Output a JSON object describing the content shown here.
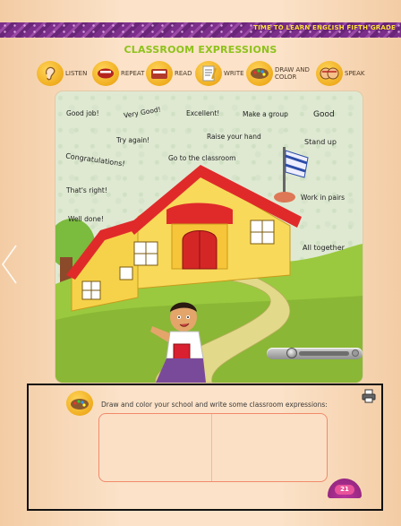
{
  "header": {
    "banner_text": "TIME TO LEARN ENGLISH FIFTH GRADE",
    "title": "CLASSROOM EXPRESSIONS"
  },
  "legend": [
    {
      "label": "LISTEN",
      "icon": "ear-icon"
    },
    {
      "label": "REPEAT",
      "icon": "mouth-icon"
    },
    {
      "label": "READ",
      "icon": "book-icon"
    },
    {
      "label": "WRITE",
      "icon": "pencil-paper-icon"
    },
    {
      "label": "DRAW AND COLOR",
      "icon": "palette-icon"
    },
    {
      "label": "SPEAK",
      "icon": "speaking-faces-icon"
    }
  ],
  "expressions": [
    "Good job!",
    "Very Good!",
    "Excellent!",
    "Make a group",
    "Good",
    "Try again!",
    "Raise your hand",
    "Stand up",
    "Congratulations!",
    "Go to the classroom",
    "That's right!",
    "Work in pairs",
    "Well done!",
    "All together"
  ],
  "activity": {
    "instruction": "Draw and color your school and write some classroom expressions:",
    "page_number": "21"
  },
  "colors": {
    "title_green": "#8ec21a",
    "banner_purple": "#7b2f8a",
    "banner_text": "#ffe23a",
    "icon_gold": "#f0ad1e",
    "badge_magenta": "#b8339c"
  }
}
